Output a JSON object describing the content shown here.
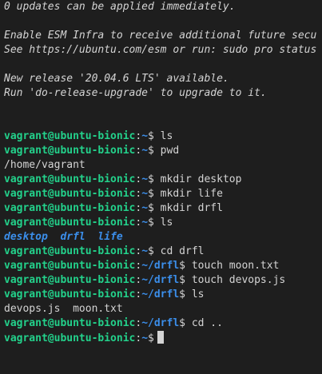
{
  "motd": {
    "updates": "0 updates can be applied immediately.",
    "esm_line1": "Enable ESM Infra to receive additional future secu",
    "esm_line2": "See https://ubuntu.com/esm or run: sudo pro status",
    "release_line1": "New release '20.04.6 LTS' available.",
    "release_line2": "Run 'do-release-upgrade' to upgrade to it."
  },
  "prompt": {
    "user_host": "vagrant@ubuntu-bionic",
    "colon": ":",
    "dollar": "$",
    "home": "~",
    "drfl": "~/drfl"
  },
  "session": {
    "cmd1": " ls",
    "cmd2": " pwd",
    "out2": "/home/vagrant",
    "cmd3": " mkdir desktop",
    "cmd4": " mkdir life",
    "cmd5": " mkdir drfl",
    "cmd6": " ls",
    "ls_dirs": [
      "desktop",
      "drfl",
      "life"
    ],
    "cmd7": " cd drfl",
    "cmd8": " touch moon.txt",
    "cmd9": " touch devops.js",
    "cmd10": " ls",
    "out10": "devops.js  moon.txt",
    "cmd11": " cd .."
  },
  "colors": {
    "background": "#1e1e1e",
    "prompt_green": "#23d18b",
    "path_blue": "#3b8eea",
    "text": "#d4d4d4"
  }
}
